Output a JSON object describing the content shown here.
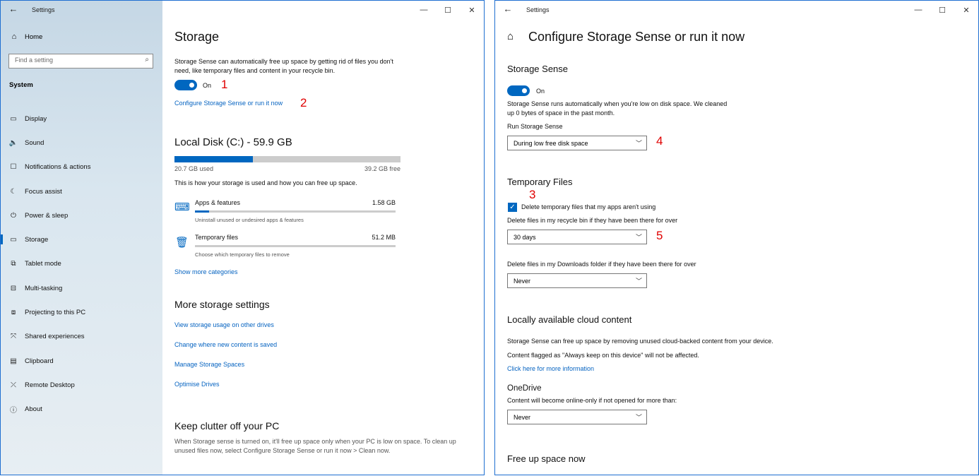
{
  "left_window": {
    "title": "Settings",
    "back_glyph": "←",
    "controls": [
      "—",
      "☐",
      "✕"
    ],
    "sidebar": {
      "home_label": "Home",
      "search_placeholder": "Find a setting",
      "section": "System",
      "items": [
        {
          "label": "Display",
          "icon": "monitor-icon",
          "glyph": "▭"
        },
        {
          "label": "Sound",
          "icon": "speaker-icon",
          "glyph": "🔈"
        },
        {
          "label": "Notifications & actions",
          "icon": "notification-icon",
          "glyph": "☐"
        },
        {
          "label": "Focus assist",
          "icon": "moon-icon",
          "glyph": "☾"
        },
        {
          "label": "Power & sleep",
          "icon": "power-icon",
          "glyph": "⏻"
        },
        {
          "label": "Storage",
          "icon": "storage-icon",
          "glyph": "▭",
          "active": true
        },
        {
          "label": "Tablet mode",
          "icon": "tablet-icon",
          "glyph": "⧉"
        },
        {
          "label": "Multi-tasking",
          "icon": "multitask-icon",
          "glyph": "⊟"
        },
        {
          "label": "Projecting to this PC",
          "icon": "projector-icon",
          "glyph": "⧈"
        },
        {
          "label": "Shared experiences",
          "icon": "shared-icon",
          "glyph": "⤧"
        },
        {
          "label": "Clipboard",
          "icon": "clipboard-icon",
          "glyph": "▤"
        },
        {
          "label": "Remote Desktop",
          "icon": "remote-icon",
          "glyph": "⤫"
        },
        {
          "label": "About",
          "icon": "info-icon",
          "glyph": "ⓘ"
        }
      ]
    },
    "main": {
      "title": "Storage",
      "description": "Storage Sense can automatically free up space by getting rid of files you don't need, like temporary files and content in your recycle bin.",
      "toggle_label": "On",
      "marker_1": "1",
      "configure_link": "Configure Storage Sense or run it now",
      "marker_2": "2",
      "disk_title": "Local Disk (C:) - 59.9 GB",
      "disk_used_fraction": 0.346,
      "used_label": "20.7 GB used",
      "free_label": "39.2 GB free",
      "usage_description": "This is how your storage is used and how you can free up space.",
      "categories": [
        {
          "name": "Apps & features",
          "size": "1.58 GB",
          "desc": "Uninstall unused or undesired apps & features",
          "fraction": 0.07
        },
        {
          "name": "Temporary files",
          "size": "51.2 MB",
          "desc": "Choose which temporary files to remove",
          "fraction": 0.0
        }
      ],
      "show_more": "Show more categories",
      "more_title": "More storage settings",
      "more_links": [
        "View storage usage on other drives",
        "Change where new content is saved",
        "Manage Storage Spaces",
        "Optimise Drives"
      ],
      "clutter_title": "Keep clutter off your PC",
      "clutter_text": "When Storage sense is turned on, it'll free up space only when your PC is low on space. To clean up unused files now, select Configure Storage Sense or run it now > Clean now."
    }
  },
  "right_window": {
    "title": "Settings",
    "back_glyph": "←",
    "controls": [
      "—",
      "☐",
      "✕"
    ],
    "page_title": "Configure Storage Sense or run it now",
    "storage_sense_heading": "Storage Sense",
    "toggle_label": "On",
    "sense_desc": "Storage Sense runs automatically when you're low on disk space. We cleaned up 0 bytes of space in the past month.",
    "run_label": "Run Storage Sense",
    "run_value": "During low free disk space",
    "marker_4": "4",
    "temp_heading": "Temporary Files",
    "marker_3": "3",
    "checkbox_label": "Delete temporary files that my apps aren't using",
    "recycle_label": "Delete files in my recycle bin if they have been there for over",
    "recycle_value": "30 days",
    "marker_5": "5",
    "downloads_label": "Delete files in my Downloads folder if they have been there for over",
    "downloads_value": "Never",
    "cloud_heading": "Locally available cloud content",
    "cloud_desc1": "Storage Sense can free up space by removing unused cloud-backed content from your device.",
    "cloud_desc2": "Content flagged as \"Always keep on this device\" will not be affected.",
    "cloud_link": "Click here for more information",
    "onedrive_heading": "OneDrive",
    "onedrive_desc": "Content will become online-only if not opened for more than:",
    "onedrive_value": "Never",
    "free_heading": "Free up space now"
  }
}
